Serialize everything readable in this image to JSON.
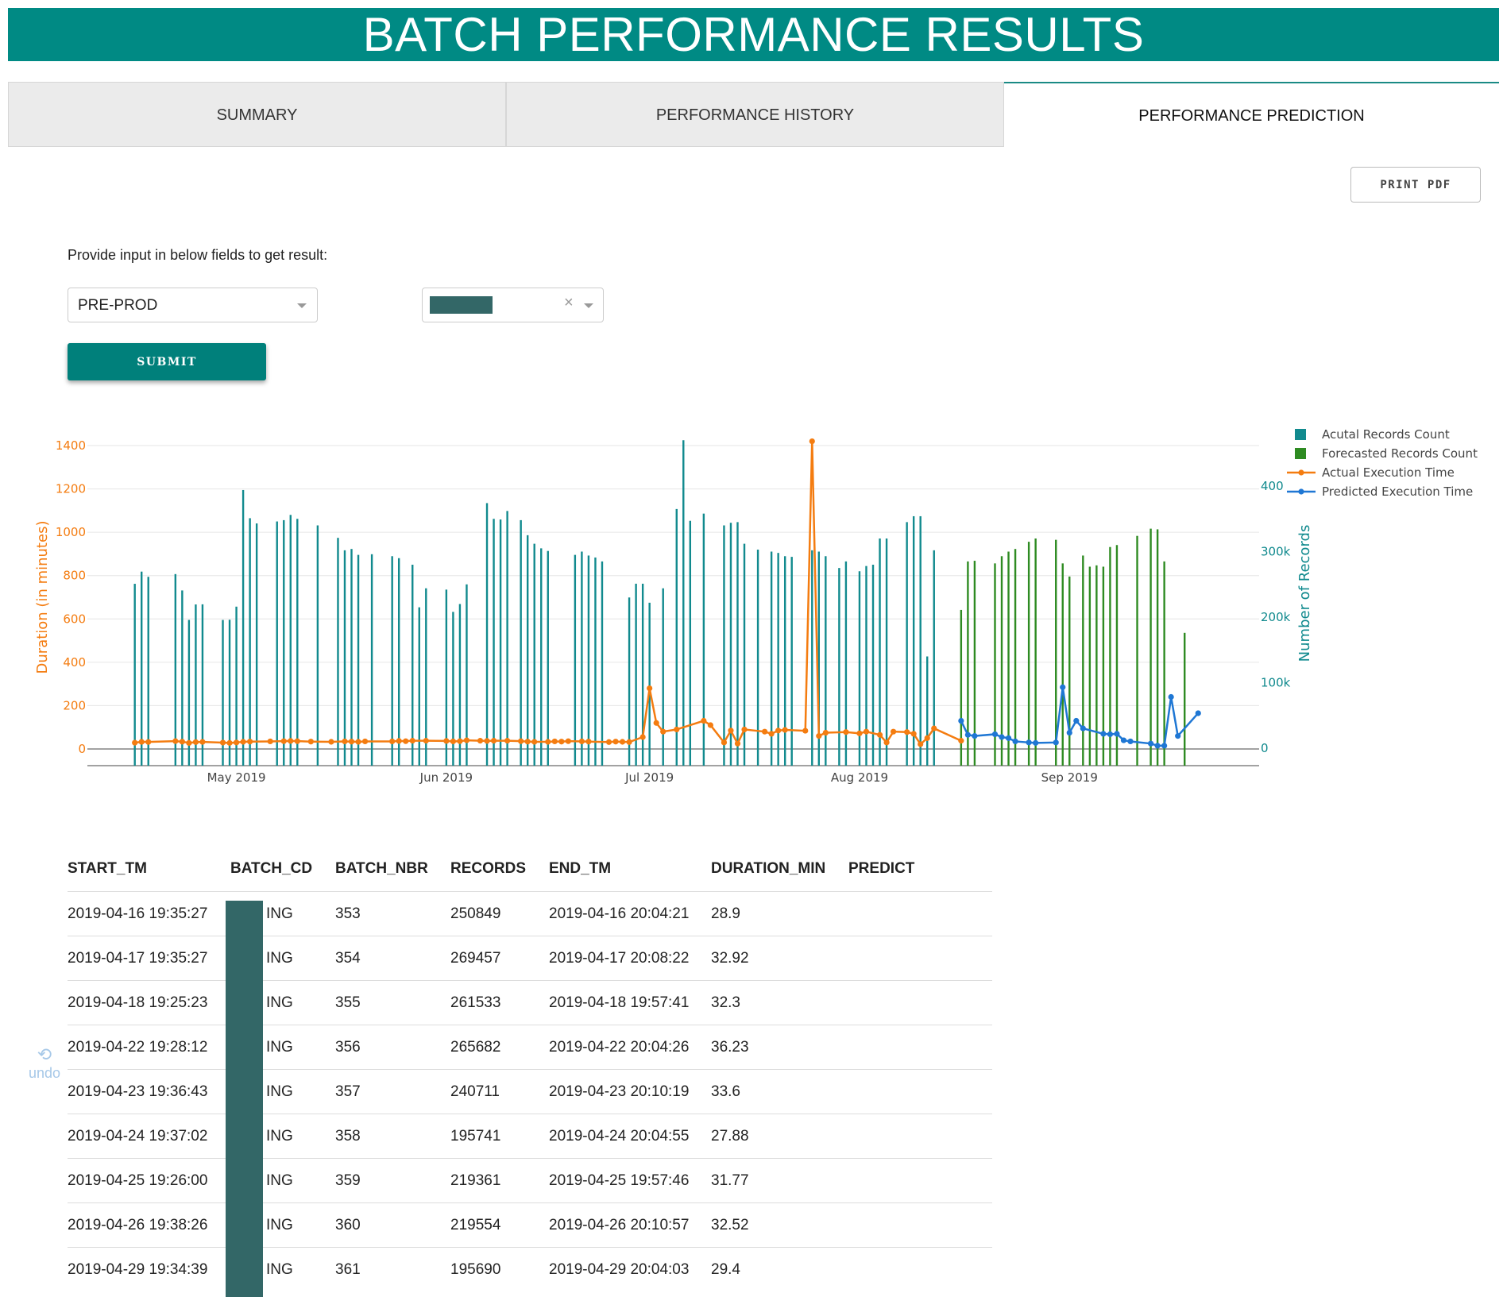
{
  "header": {
    "title": "BATCH PERFORMANCE RESULTS"
  },
  "tabs": [
    {
      "label": "SUMMARY"
    },
    {
      "label": "PERFORMANCE HISTORY"
    },
    {
      "label": "PERFORMANCE PREDICTION",
      "active": true
    }
  ],
  "toolbar": {
    "print_label": "PRINT PDF"
  },
  "form": {
    "prompt": "Provide input in below fields to get result:",
    "environment_value": "PRE-PROD",
    "batch_value": "",
    "clear_symbol": "×",
    "submit_label": "SUBMIT"
  },
  "undo": {
    "icon": "undo-icon",
    "glyph": "⟲",
    "label": "undo"
  },
  "colors": {
    "accent": "#008a84",
    "actual_records": "#118a8e",
    "forecast_records": "#2e8b22",
    "actual_time": "#f47c10",
    "predicted_time": "#1f77d4"
  },
  "chart_data": {
    "type": "bar+line",
    "y_left": {
      "label": "Duration (in minutes)",
      "range": [
        0,
        1400
      ],
      "ticks": [
        0,
        200,
        400,
        600,
        800,
        1000,
        1200,
        1400
      ]
    },
    "y_right": {
      "label": "Number of Records",
      "range": [
        0,
        400000
      ],
      "ticks": [
        0,
        100000,
        200000,
        300000,
        400000
      ],
      "tick_labels": [
        "0",
        "100k",
        "200k",
        "300k",
        "400"
      ]
    },
    "x": {
      "range": [
        "2019-04-09",
        "2019-09-29"
      ],
      "ticks": [
        "2019-05-01",
        "2019-06-01",
        "2019-07-01",
        "2019-08-01",
        "2019-09-01"
      ],
      "tick_labels": [
        "May 2019",
        "Jun 2019",
        "Jul 2019",
        "Aug 2019",
        "Sep 2019"
      ]
    },
    "grid": true,
    "legend_position": "top-right",
    "series": [
      {
        "name": "Acutal Records Count",
        "kind": "bar",
        "points": [
          [
            "2019-04-16",
            250849
          ],
          [
            "2019-04-17",
            269457
          ],
          [
            "2019-04-18",
            261533
          ],
          [
            "2019-04-22",
            265682
          ],
          [
            "2019-04-23",
            240711
          ],
          [
            "2019-04-24",
            195741
          ],
          [
            "2019-04-25",
            219361
          ],
          [
            "2019-04-26",
            219554
          ],
          [
            "2019-04-29",
            195690
          ],
          [
            "2019-04-30",
            196000
          ],
          [
            "2019-05-01",
            216000
          ],
          [
            "2019-05-02",
            394000
          ],
          [
            "2019-05-03",
            351000
          ],
          [
            "2019-05-04",
            343000
          ],
          [
            "2019-05-07",
            346000
          ],
          [
            "2019-05-08",
            348000
          ],
          [
            "2019-05-09",
            356000
          ],
          [
            "2019-05-10",
            350000
          ],
          [
            "2019-05-13",
            340000
          ],
          [
            "2019-05-16",
            321000
          ],
          [
            "2019-05-17",
            302000
          ],
          [
            "2019-05-18",
            304000
          ],
          [
            "2019-05-19",
            295000
          ],
          [
            "2019-05-21",
            296000
          ],
          [
            "2019-05-24",
            293000
          ],
          [
            "2019-05-25",
            290000
          ],
          [
            "2019-05-27",
            280000
          ],
          [
            "2019-05-28",
            215000
          ],
          [
            "2019-05-29",
            244000
          ],
          [
            "2019-06-01",
            242000
          ],
          [
            "2019-06-02",
            208000
          ],
          [
            "2019-06-03",
            220000
          ],
          [
            "2019-06-04",
            250000
          ],
          [
            "2019-06-07",
            374000
          ],
          [
            "2019-06-08",
            350000
          ],
          [
            "2019-06-09",
            349000
          ],
          [
            "2019-06-10",
            362000
          ],
          [
            "2019-06-12",
            348000
          ],
          [
            "2019-06-13",
            325000
          ],
          [
            "2019-06-14",
            312000
          ],
          [
            "2019-06-15",
            305000
          ],
          [
            "2019-06-16",
            301000
          ],
          [
            "2019-06-20",
            295000
          ],
          [
            "2019-06-21",
            300000
          ],
          [
            "2019-06-22",
            294000
          ],
          [
            "2019-06-23",
            291000
          ],
          [
            "2019-06-24",
            285000
          ],
          [
            "2019-06-28",
            230000
          ],
          [
            "2019-06-29",
            251000
          ],
          [
            "2019-06-30",
            251000
          ],
          [
            "2019-07-01",
            222000
          ],
          [
            "2019-07-03",
            244000
          ],
          [
            "2019-07-05",
            365000
          ],
          [
            "2019-07-06",
            470000
          ],
          [
            "2019-07-07",
            347000
          ],
          [
            "2019-07-09",
            358000
          ],
          [
            "2019-07-12",
            340000
          ],
          [
            "2019-07-13",
            344000
          ],
          [
            "2019-07-14",
            345000
          ],
          [
            "2019-07-15",
            312000
          ],
          [
            "2019-07-17",
            303000
          ],
          [
            "2019-07-19",
            300000
          ],
          [
            "2019-07-20",
            298000
          ],
          [
            "2019-07-21",
            293000
          ],
          [
            "2019-07-22",
            292000
          ],
          [
            "2019-07-25",
            302000
          ],
          [
            "2019-07-26",
            300000
          ],
          [
            "2019-07-27",
            293000
          ],
          [
            "2019-07-29",
            275000
          ],
          [
            "2019-07-30",
            285000
          ],
          [
            "2019-08-01",
            270000
          ],
          [
            "2019-08-02",
            278000
          ],
          [
            "2019-08-03",
            280000
          ],
          [
            "2019-08-04",
            320000
          ],
          [
            "2019-08-05",
            320000
          ],
          [
            "2019-08-08",
            345000
          ],
          [
            "2019-08-09",
            354000
          ],
          [
            "2019-08-10",
            354000
          ],
          [
            "2019-08-11",
            140000
          ],
          [
            "2019-08-12",
            302000
          ]
        ]
      },
      {
        "name": "Forecasted Records Count",
        "kind": "bar",
        "points": [
          [
            "2019-08-16",
            211000
          ],
          [
            "2019-08-17",
            285000
          ],
          [
            "2019-08-18",
            286000
          ],
          [
            "2019-08-21",
            282000
          ],
          [
            "2019-08-22",
            293000
          ],
          [
            "2019-08-23",
            300000
          ],
          [
            "2019-08-24",
            304000
          ],
          [
            "2019-08-26",
            315000
          ],
          [
            "2019-08-27",
            320000
          ],
          [
            "2019-08-30",
            318000
          ],
          [
            "2019-08-31",
            282000
          ],
          [
            "2019-09-01",
            262000
          ],
          [
            "2019-09-03",
            294000
          ],
          [
            "2019-09-04",
            277000
          ],
          [
            "2019-09-05",
            279000
          ],
          [
            "2019-09-06",
            277000
          ],
          [
            "2019-09-07",
            307000
          ],
          [
            "2019-09-08",
            310000
          ],
          [
            "2019-09-11",
            324000
          ],
          [
            "2019-09-13",
            335000
          ],
          [
            "2019-09-14",
            334000
          ],
          [
            "2019-09-15",
            285000
          ],
          [
            "2019-09-18",
            176000
          ]
        ]
      },
      {
        "name": "Actual Execution Time",
        "kind": "line",
        "points": [
          [
            "2019-04-16",
            28.9
          ],
          [
            "2019-04-17",
            32.92
          ],
          [
            "2019-04-18",
            32.3
          ],
          [
            "2019-04-22",
            36.23
          ],
          [
            "2019-04-23",
            33.6
          ],
          [
            "2019-04-24",
            27.88
          ],
          [
            "2019-04-25",
            31.77
          ],
          [
            "2019-04-26",
            32.52
          ],
          [
            "2019-04-29",
            29.4
          ],
          [
            "2019-04-30",
            28
          ],
          [
            "2019-05-01",
            30
          ],
          [
            "2019-05-02",
            33
          ],
          [
            "2019-05-03",
            34
          ],
          [
            "2019-05-06",
            35
          ],
          [
            "2019-05-08",
            36
          ],
          [
            "2019-05-09",
            37
          ],
          [
            "2019-05-10",
            36
          ],
          [
            "2019-05-12",
            34
          ],
          [
            "2019-05-15",
            33
          ],
          [
            "2019-05-17",
            35
          ],
          [
            "2019-05-18",
            34
          ],
          [
            "2019-05-19",
            33
          ],
          [
            "2019-05-20",
            35
          ],
          [
            "2019-05-24",
            35
          ],
          [
            "2019-05-25",
            37
          ],
          [
            "2019-05-26",
            36
          ],
          [
            "2019-05-27",
            38
          ],
          [
            "2019-05-29",
            38
          ],
          [
            "2019-06-01",
            37
          ],
          [
            "2019-06-02",
            35
          ],
          [
            "2019-06-03",
            36
          ],
          [
            "2019-06-04",
            40
          ],
          [
            "2019-06-06",
            38
          ],
          [
            "2019-06-07",
            37
          ],
          [
            "2019-06-08",
            38
          ],
          [
            "2019-06-10",
            38
          ],
          [
            "2019-06-12",
            36
          ],
          [
            "2019-06-13",
            34
          ],
          [
            "2019-06-14",
            33
          ],
          [
            "2019-06-16",
            33
          ],
          [
            "2019-06-17",
            35
          ],
          [
            "2019-06-18",
            34
          ],
          [
            "2019-06-19",
            36
          ],
          [
            "2019-06-21",
            35
          ],
          [
            "2019-06-22",
            34
          ],
          [
            "2019-06-25",
            32
          ],
          [
            "2019-06-26",
            34
          ],
          [
            "2019-06-27",
            33
          ],
          [
            "2019-06-28",
            32
          ],
          [
            "2019-06-30",
            55
          ],
          [
            "2019-07-01",
            280
          ],
          [
            "2019-07-02",
            120
          ],
          [
            "2019-07-03",
            80
          ],
          [
            "2019-07-05",
            90
          ],
          [
            "2019-07-09",
            130
          ],
          [
            "2019-07-10",
            110
          ],
          [
            "2019-07-12",
            30
          ],
          [
            "2019-07-13",
            85
          ],
          [
            "2019-07-14",
            25
          ],
          [
            "2019-07-15",
            90
          ],
          [
            "2019-07-18",
            80
          ],
          [
            "2019-07-19",
            70
          ],
          [
            "2019-07-20",
            85
          ],
          [
            "2019-07-21",
            88
          ],
          [
            "2019-07-24",
            84
          ],
          [
            "2019-07-25",
            1420
          ],
          [
            "2019-07-26",
            60
          ],
          [
            "2019-07-27",
            75
          ],
          [
            "2019-07-30",
            78
          ],
          [
            "2019-08-01",
            72
          ],
          [
            "2019-08-02",
            80
          ],
          [
            "2019-08-04",
            65
          ],
          [
            "2019-08-05",
            30
          ],
          [
            "2019-08-06",
            80
          ],
          [
            "2019-08-08",
            78
          ],
          [
            "2019-08-09",
            70
          ],
          [
            "2019-08-10",
            22
          ],
          [
            "2019-08-11",
            50
          ],
          [
            "2019-08-12",
            95
          ],
          [
            "2019-08-16",
            38
          ]
        ]
      },
      {
        "name": "Predicted Execution Time",
        "kind": "line",
        "points": [
          [
            "2019-08-16",
            130
          ],
          [
            "2019-08-17",
            65
          ],
          [
            "2019-08-18",
            60
          ],
          [
            "2019-08-21",
            68
          ],
          [
            "2019-08-22",
            55
          ],
          [
            "2019-08-23",
            50
          ],
          [
            "2019-08-24",
            35
          ],
          [
            "2019-08-26",
            30
          ],
          [
            "2019-08-27",
            28
          ],
          [
            "2019-08-30",
            30
          ],
          [
            "2019-08-31",
            285
          ],
          [
            "2019-09-01",
            75
          ],
          [
            "2019-09-02",
            130
          ],
          [
            "2019-09-03",
            95
          ],
          [
            "2019-09-06",
            70
          ],
          [
            "2019-09-07",
            68
          ],
          [
            "2019-09-08",
            70
          ],
          [
            "2019-09-09",
            40
          ],
          [
            "2019-09-10",
            35
          ],
          [
            "2019-09-13",
            25
          ],
          [
            "2019-09-14",
            15
          ],
          [
            "2019-09-15",
            15
          ],
          [
            "2019-09-16",
            240
          ],
          [
            "2019-09-17",
            60
          ],
          [
            "2019-09-20",
            165
          ]
        ]
      }
    ]
  },
  "table": {
    "columns": [
      "START_TM",
      "BATCH_CD",
      "BATCH_NBR",
      "RECORDS",
      "END_TM",
      "DURATION_MIN",
      "PREDICT"
    ],
    "rows": [
      [
        "2019-04-16 19:35:27",
        "ING",
        "353",
        "250849",
        "2019-04-16 20:04:21",
        "28.9",
        ""
      ],
      [
        "2019-04-17 19:35:27",
        "ING",
        "354",
        "269457",
        "2019-04-17 20:08:22",
        "32.92",
        ""
      ],
      [
        "2019-04-18 19:25:23",
        "ING",
        "355",
        "261533",
        "2019-04-18 19:57:41",
        "32.3",
        ""
      ],
      [
        "2019-04-22 19:28:12",
        "ING",
        "356",
        "265682",
        "2019-04-22 20:04:26",
        "36.23",
        ""
      ],
      [
        "2019-04-23 19:36:43",
        "ING",
        "357",
        "240711",
        "2019-04-23 20:10:19",
        "33.6",
        ""
      ],
      [
        "2019-04-24 19:37:02",
        "ING",
        "358",
        "195741",
        "2019-04-24 20:04:55",
        "27.88",
        ""
      ],
      [
        "2019-04-25 19:26:00",
        "ING",
        "359",
        "219361",
        "2019-04-25 19:57:46",
        "31.77",
        ""
      ],
      [
        "2019-04-26 19:38:26",
        "ING",
        "360",
        "219554",
        "2019-04-26 20:10:57",
        "32.52",
        ""
      ],
      [
        "2019-04-29 19:34:39",
        "ING",
        "361",
        "195690",
        "2019-04-29 20:04:03",
        "29.4",
        ""
      ]
    ]
  }
}
